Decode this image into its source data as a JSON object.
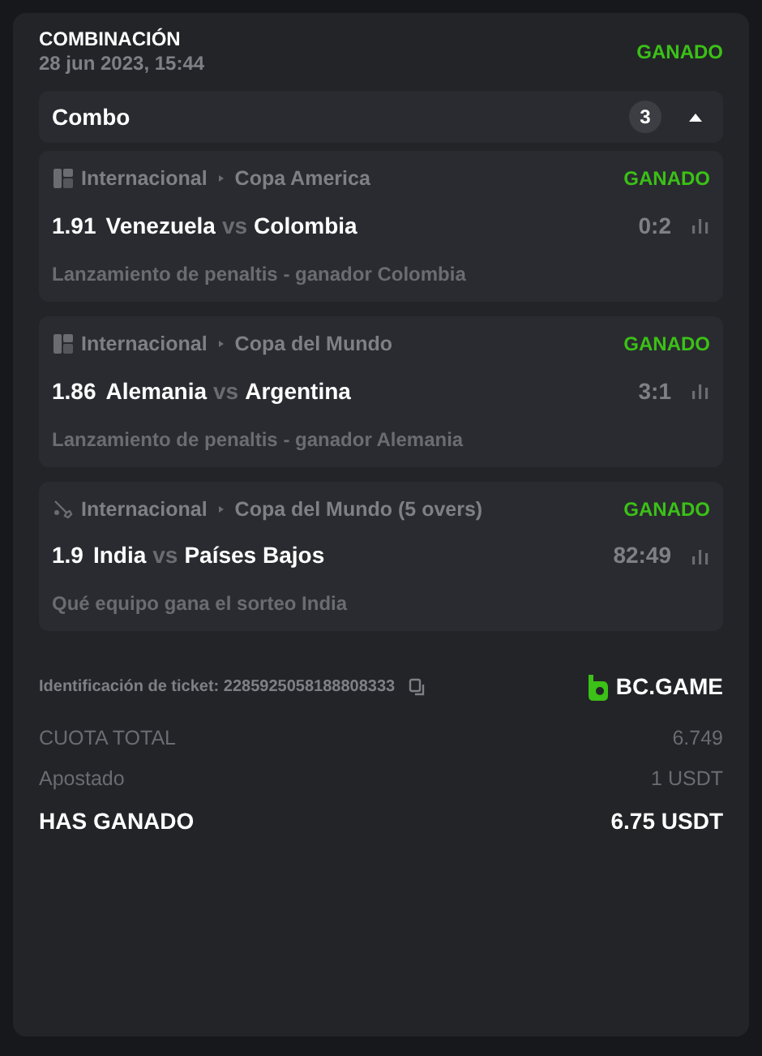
{
  "header": {
    "title": "COMBINACIÓN",
    "date": "28 jun 2023, 15:44",
    "status": "GANADO",
    "won": true
  },
  "combo": {
    "label": "Combo",
    "count": "3",
    "expanded": true
  },
  "bets": [
    {
      "kind": "football",
      "category": "Internacional",
      "tournament": "Copa America",
      "status": "GANADO",
      "won": true,
      "odds": "1.91",
      "home": "Venezuela",
      "vs": "vs",
      "away": "Colombia",
      "score": "0:2",
      "market": "Lanzamiento de penaltis - ganador Colombia"
    },
    {
      "kind": "football",
      "category": "Internacional",
      "tournament": "Copa del Mundo",
      "status": "GANADO",
      "won": true,
      "odds": "1.86",
      "home": "Alemania",
      "vs": "vs",
      "away": "Argentina",
      "score": "3:1",
      "market": "Lanzamiento de penaltis - ganador Alemania"
    },
    {
      "kind": "cricket",
      "category": "Internacional",
      "tournament": "Copa del Mundo (5 overs)",
      "status": "GANADO",
      "won": true,
      "odds": "1.9",
      "home": "India",
      "vs": "vs",
      "away": "Países Bajos",
      "score": "82:49",
      "market": "Qué equipo gana el sorteo India"
    }
  ],
  "ticket": {
    "label": "Identificación de ticket: 2285925058188808333",
    "brand": "BC.GAME"
  },
  "summary": [
    {
      "kind": "muted",
      "label": "CUOTA TOTAL",
      "value": "6.749"
    },
    {
      "kind": "muted",
      "label": "Apostado",
      "value": "1 USDT"
    },
    {
      "kind": "total",
      "label": "HAS GANADO",
      "value": "6.75 USDT"
    }
  ]
}
